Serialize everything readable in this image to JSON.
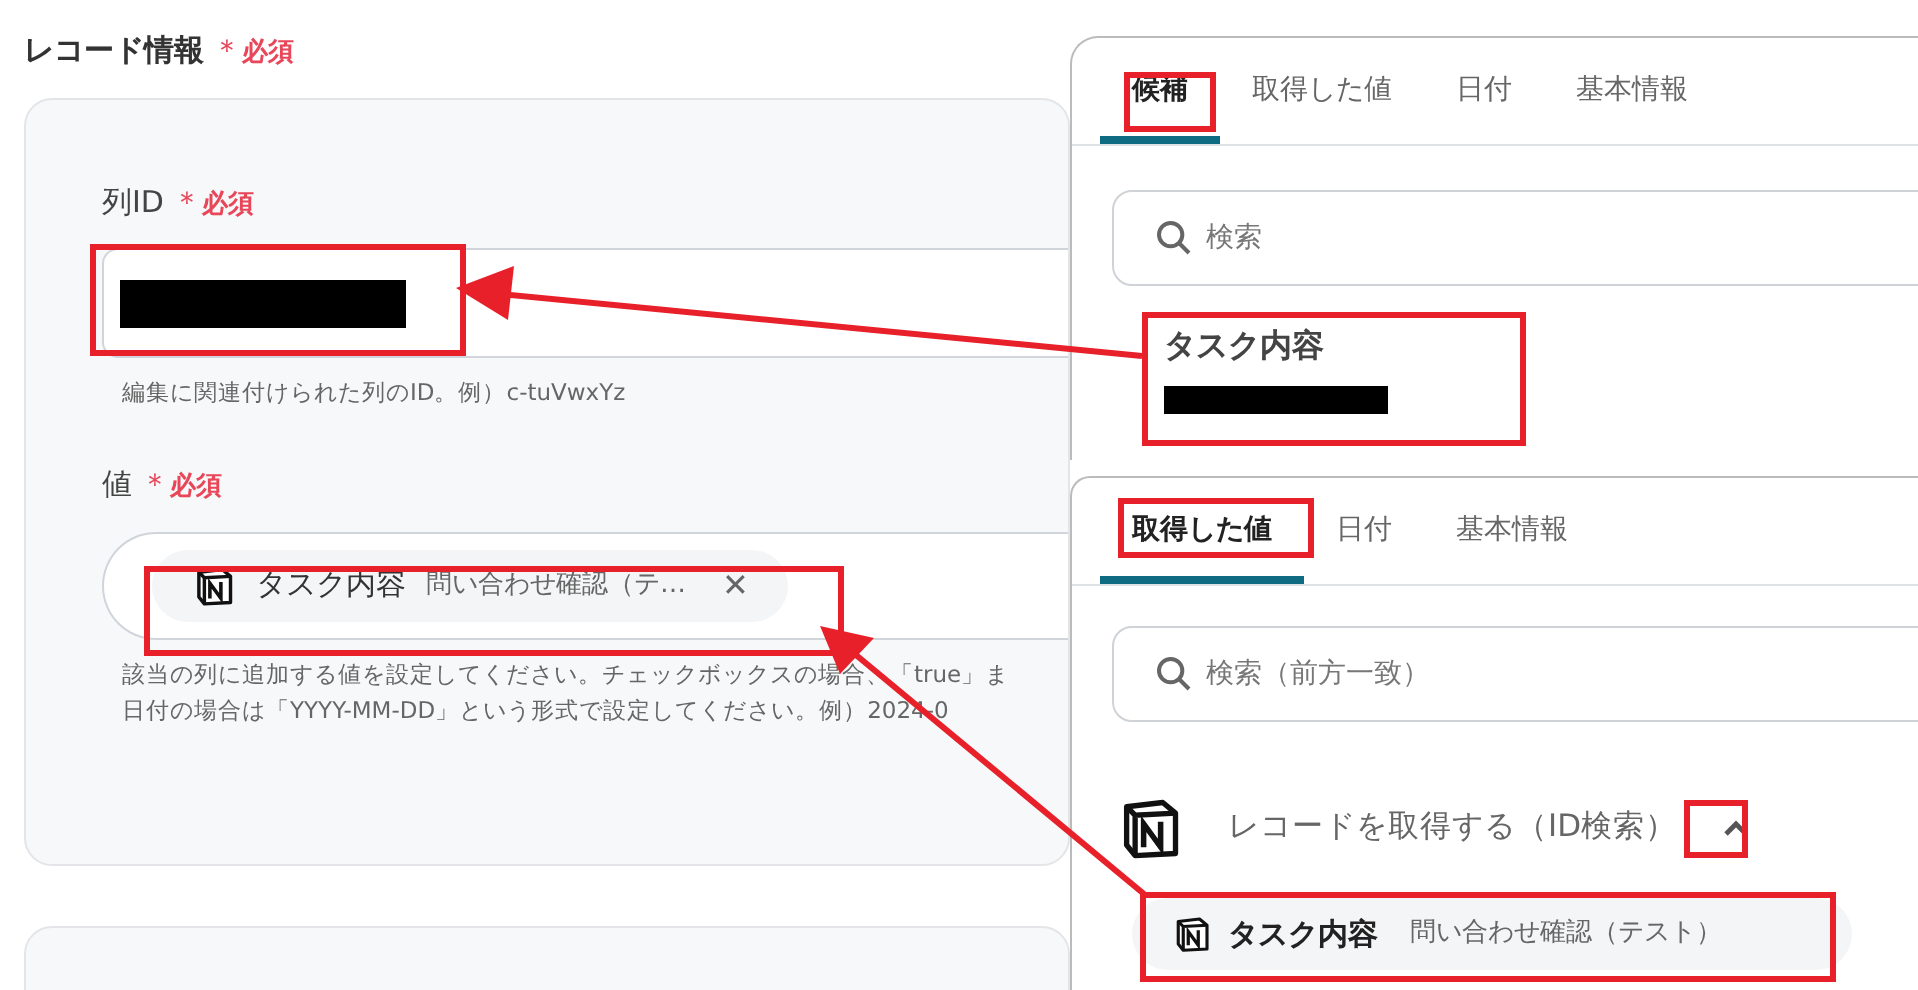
{
  "form": {
    "title": "レコード情報",
    "required_mark": "＊",
    "required_label": "必須",
    "fields": [
      {
        "kind": "text",
        "label": "列ID",
        "required_mark": "＊",
        "required_label": "必須",
        "hint_lines": [
          "編集に関連付けられた列のID。例）c-tuVwxYz"
        ]
      },
      {
        "kind": "token",
        "label": "値",
        "required_mark": "＊",
        "required_label": "必須",
        "token": {
          "name": "タスク内容",
          "value": "問い合わせ確認（テ…",
          "remove": "✕"
        },
        "hint_lines": [
          "該当の列に追加する値を設定してください。チェックボックスの場合、「true」ま",
          "日付の場合は「YYYY-MM-DD」という形式で設定してください。例）2024-0"
        ]
      }
    ]
  },
  "suggestion_panel": {
    "tabs": [
      {
        "label": "候補",
        "selected": true
      },
      {
        "label": "取得した値",
        "selected": false
      },
      {
        "label": "日付",
        "selected": false
      },
      {
        "label": "基本情報",
        "selected": false
      }
    ],
    "search": {
      "placeholder": "検索"
    },
    "item": {
      "title": "タスク内容"
    }
  },
  "output_panel": {
    "tabs": [
      {
        "label": "取得した値",
        "selected": true
      },
      {
        "label": "日付",
        "selected": false
      },
      {
        "label": "基本情報",
        "selected": false
      }
    ],
    "search": {
      "placeholder": "検索（前方一致）"
    },
    "group": {
      "title": "レコードを取得する（ID検索）",
      "expanded": true,
      "items": [
        {
          "name": "タスク内容",
          "value": "問い合わせ確認（テスト）"
        }
      ]
    }
  }
}
